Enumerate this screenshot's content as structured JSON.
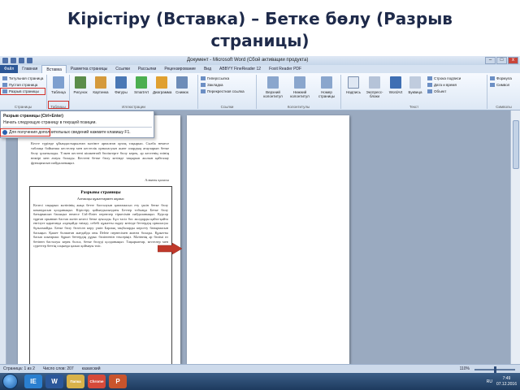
{
  "slide": {
    "title": "Кірістіру (Вставка) – Бетке бөлу (Разрыв страницы)"
  },
  "window": {
    "title": "Документ - Microsoft Word (Сбой активации продукта)",
    "controls": {
      "minimize": "–",
      "maximize": "□",
      "close": "x"
    }
  },
  "tabs": [
    {
      "label": "Файл"
    },
    {
      "label": "Главная"
    },
    {
      "label": "Вставка"
    },
    {
      "label": "Разметка страницы"
    },
    {
      "label": "Ссылки"
    },
    {
      "label": "Рассылки"
    },
    {
      "label": "Рецензирование"
    },
    {
      "label": "Вид"
    },
    {
      "label": "ABBYY FineReader 12"
    },
    {
      "label": "Foxit Reader PDF"
    }
  ],
  "ribbon": {
    "pages": {
      "cover": "Титульная страница",
      "blank": "Пустая страница",
      "break": "Разрыв страницы",
      "group": "Страницы"
    },
    "tables": {
      "label": "Таблица",
      "group": "Таблицы"
    },
    "illustrations": {
      "items": [
        "Рисунок",
        "Картинка",
        "Фигуры",
        "SmartArt",
        "Диаграмма",
        "Снимок"
      ],
      "group": "Иллюстрации"
    },
    "links": {
      "items": [
        "Гиперссылка",
        "Закладка",
        "Перекрестная ссылка"
      ],
      "group": "Ссылки"
    },
    "header_footer": {
      "items": [
        "Верхний колонтитул",
        "Нижний колонтитул",
        "Номер страницы"
      ],
      "group": "Колонтитулы"
    },
    "text": {
      "items": [
        "Надпись",
        "Экспресс-блоки",
        "WordArt",
        "Буквица"
      ],
      "side": [
        "Строка подписи",
        "Дата и время",
        "Объект"
      ],
      "group": "Текст"
    },
    "symbols": {
      "items": [
        "Формула",
        "Символ"
      ],
      "group": "Символы"
    }
  },
  "dropdown": {
    "item1": "Разрыв страницы (Ctrl+Enter)",
    "item2": "Начать следующую страницу в текущей позиции.",
    "item3": "Для получения дополнительных сведений нажмите клавишу F1."
  },
  "document": {
    "top_text": "Кесте түрінде ұйымдастырылған мәтінге арналған ортақ тақырып. Сызба немесе таблица бойынша кестелер мен кестелік орналасуын және олардың атауларын бетке бөлу ұсынылады. Үлкен кестені кішкентай бөліктерге бөлу керек, әр кестенің өзінің нөмірі мен атауы болады. Кестені бетке бөлу кезінде тақырып жолын қайталау функциясын пайдаланыңыз.",
    "signature": "Алматы қаласы",
    "framed": {
      "header": "Разрывы страницы",
      "subtitle": "Алғашқы құжаттармен жұмыс",
      "text": "Келесі тақырып мәтінінің жаңа бетте басталуын қамтамасыз ету үшін бетке бөлу командасын қолданыңыз. Кірістіру қойындысындағы Беттер тобында Бетке бөлу батырмасын басыңыз немесе Ctrl+Enter пернелер тіркесімін пайдаланыңыз. Курсор тұрған орыннан бастап мәтін келесі бетке ауысады. Бұл тәсіл бос жолдарды қайта-қайта енгізуге қарағанда әлдеқайда тиімді, себебі құжатты өңдеу кезінде беттердің орналасуы бұзылмайды. Бетке бөлу белгісін көру үшін Барлық таңбаларды көрсету батырмасын басыңыз. Қажет болмаған жағдайда оны Delete пернесімен жоюға болады. Құжатты басып шығармас бұрын беттердің дұрыс бөлінгенін тексеріңіз. Мәтіннің әр бөлімі өз бетінен басталуы керек болса, бетке бөлуді қолданыңыз. Тақырыптар, кестелер мен суреттер беттің соңында қалып қоймауы тиіс."
    }
  },
  "status": {
    "page": "Страница: 1 из 2",
    "words": "Число слов: 207",
    "lang": "казахский",
    "zoom": "110%"
  },
  "taskbar": {
    "apps": [
      "IE",
      "W",
      "Папка",
      "Chrome",
      "P"
    ],
    "lang": "RU",
    "time": "7:49",
    "date": "07.12.2016"
  }
}
